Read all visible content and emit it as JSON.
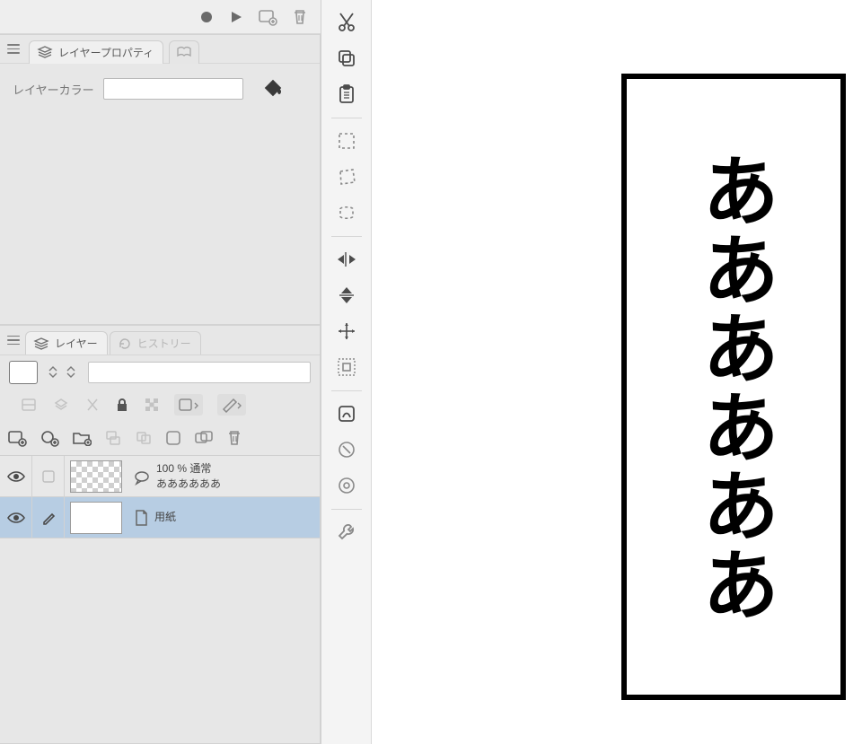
{
  "panels": {
    "layer_property": {
      "tab_label": "レイヤープロパティ",
      "layer_color_label": "レイヤーカラー"
    },
    "layer_panel": {
      "tab_label": "レイヤー",
      "history_tab_label": "ヒストリー"
    }
  },
  "layers": [
    {
      "opacity_line": "100 % 通常",
      "name": "ああああああ"
    },
    {
      "opacity_line": "",
      "name": "用紙"
    }
  ],
  "canvas": {
    "balloon_text": "ああああああ"
  },
  "icons": {
    "record": "record-icon",
    "play": "play-icon",
    "add_clip": "add-clip-icon",
    "trash": "trash-icon",
    "cut": "cut-icon",
    "copy": "copy-icon",
    "paste": "paste-icon",
    "select_rect": "select-rect-icon",
    "select_free": "select-free-icon",
    "select_pinch": "select-pinch-icon",
    "flip_h": "flip-horizontal-icon",
    "flip_v": "flip-vertical-icon",
    "move_arrows": "move-arrows-icon",
    "scale_down": "scale-down-icon",
    "transform_a": "transform-a-icon",
    "transform_b": "transform-b-icon",
    "wrench": "wrench-icon"
  }
}
